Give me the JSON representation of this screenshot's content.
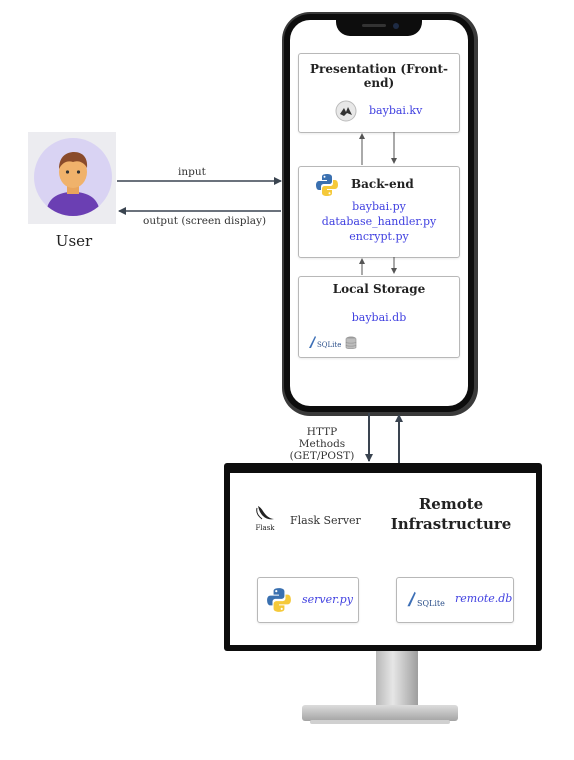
{
  "user": {
    "label": "User"
  },
  "arrows": {
    "input": "input",
    "output": "output (screen display)",
    "http_line1": "HTTP Methods",
    "http_line2": "(GET/POST)"
  },
  "phone": {
    "presentation": {
      "title": "Presentation (Front-end)",
      "file": "baybai.kv",
      "icon": "kivy-icon"
    },
    "backend": {
      "title": "Back-end",
      "files": [
        "baybai.py",
        "database_handler.py",
        "encrypt.py"
      ],
      "icon": "python-icon"
    },
    "storage": {
      "title": "Local Storage",
      "file": "baybai.db",
      "sqlite_label": "SQLite",
      "icons": [
        "sqlite-icon",
        "database-icon"
      ]
    }
  },
  "remote": {
    "title_line1": "Remote",
    "title_line2": "Infrastructure",
    "flask_label": "Flask Server",
    "flask_logo_text": "Flask",
    "server_file": "server.py",
    "db_file": "remote.db",
    "sqlite_label": "SQLite"
  },
  "colors": {
    "file_text": "#3f3fe0",
    "arrow": "#3a4450"
  }
}
